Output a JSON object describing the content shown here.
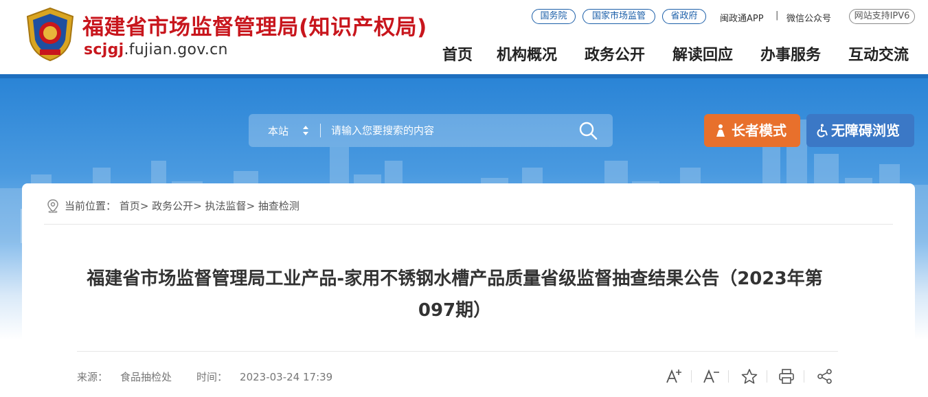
{
  "header": {
    "site_title": "福建省市场监督管理局(知识产权局)",
    "domain_prefix": "scjgj",
    "domain_suffix": ".fujian.gov.cn",
    "top_links": {
      "gov": "国务院",
      "samr": "国家市场监管",
      "province": "省政府",
      "app": "闽政通APP",
      "separator": "|",
      "wechat": "微信公众号",
      "ipv6": "网站支持IPV6"
    },
    "nav": [
      "首页",
      "机构概况",
      "政务公开",
      "解读回应",
      "办事服务",
      "互动交流"
    ]
  },
  "search": {
    "scope": "本站",
    "placeholder": "请输入您要搜索的内容"
  },
  "accessibility": {
    "elder_mode": "长者模式",
    "barrier_free": "无障碍浏览"
  },
  "breadcrumb": {
    "label": "当前位置：",
    "items": [
      "首页",
      "政务公开",
      "执法监督",
      "抽查检测"
    ],
    "separator": ">"
  },
  "article": {
    "title": "福建省市场监督管理局工业产品-家用不锈钢水槽产品质量省级监督抽查结果公告（2023年第097期）",
    "source_label": "来源：",
    "source": "食品抽检处",
    "time_label": "时间：",
    "time": "2023-03-24 17:39"
  },
  "tools": {
    "font_increase": "A+",
    "font_decrease": "A-",
    "favorite": "star-icon",
    "print": "printer-icon",
    "share": "share-icon"
  },
  "colors": {
    "brand_red": "#c8161d",
    "brand_blue": "#1e6fbf",
    "elder_orange": "#e8702c",
    "access_blue": "#3b78c6"
  }
}
